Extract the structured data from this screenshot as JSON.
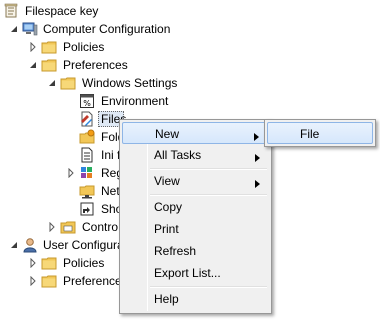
{
  "tree": {
    "root_label": "Filespace key",
    "computer_config_label": "Computer Configuration",
    "policies_label": "Policies",
    "preferences_label": "Preferences",
    "windows_settings_label": "Windows Settings",
    "environment_label": "Environment",
    "files_label": "Files",
    "folders_label": "Fold",
    "ini_files_label": "Ini f",
    "registry_label": "Reg",
    "network_shares_label": "Net",
    "shortcuts_label": "Sho",
    "control_panel_label": "Contro",
    "user_config_label": "User Configura",
    "user_policies_label": "Policies",
    "user_preferences_label": "Preference"
  },
  "context_menu": {
    "new": "New",
    "all_tasks": "All Tasks",
    "view": "View",
    "copy": "Copy",
    "print": "Print",
    "refresh": "Refresh",
    "export_list": "Export List...",
    "help": "Help"
  },
  "submenu": {
    "file": "File"
  },
  "colors": {
    "menu_background": "#f0f0f0",
    "highlight_border": "#8eb5e6",
    "folder_yellow": "#f2c757"
  }
}
